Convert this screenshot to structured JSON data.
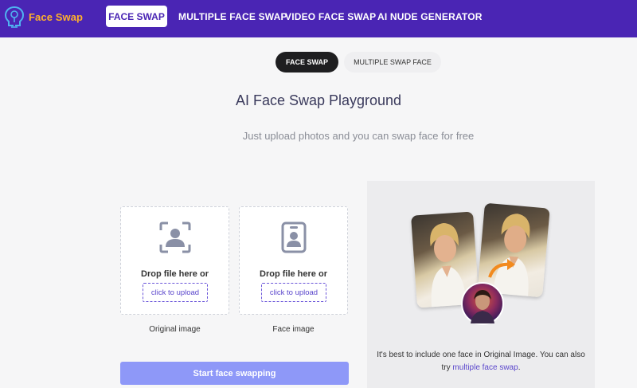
{
  "brand": {
    "name": "Face Swap"
  },
  "nav": {
    "active": "FACE SWAP",
    "items": [
      "MULTIPLE FACE SWAP",
      "VIDEO FACE SWAP",
      "AI NUDE GENERATOR"
    ]
  },
  "subtabs": {
    "active": "FACE SWAP",
    "other": "MULTIPLE SWAP FACE"
  },
  "hero": {
    "title": "AI Face Swap Playground",
    "subtitle": "Just upload photos and you can swap face for free"
  },
  "uploads": [
    {
      "drop_text": "Drop file here or",
      "button": "click to upload",
      "label": "Original image",
      "icon": "face-scan-icon"
    },
    {
      "drop_text": "Drop file here or",
      "button": "click to upload",
      "label": "Face image",
      "icon": "id-badge-icon"
    }
  ],
  "start_button": "Start face swapping",
  "hint": {
    "prefix": "It's best to include one face in Original Image. You can also try",
    "link": "multiple face swap",
    "suffix": "."
  },
  "colors": {
    "brand_purple": "#4a25b4",
    "logo_orange": "#ffb12b",
    "accent": "#5b47cc",
    "start_button": "#8e98f8"
  }
}
